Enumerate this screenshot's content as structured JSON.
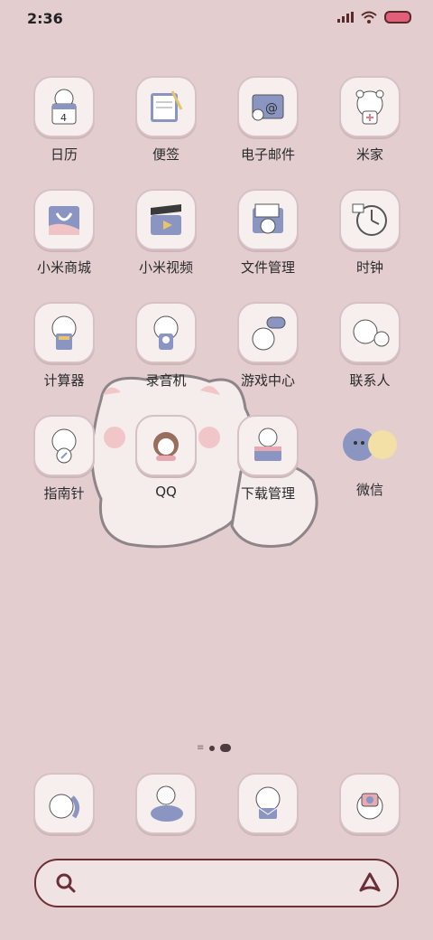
{
  "status_bar": {
    "time": "2:36"
  },
  "apps": [
    {
      "id": "calendar",
      "label": "日历",
      "icon": "calendar-bear-icon"
    },
    {
      "id": "notes",
      "label": "便签",
      "icon": "notes-icon"
    },
    {
      "id": "email",
      "label": "电子邮件",
      "icon": "email-icon"
    },
    {
      "id": "mijia",
      "label": "米家",
      "icon": "mijia-bear-icon"
    },
    {
      "id": "mall",
      "label": "小米商城",
      "icon": "shopping-bag-icon"
    },
    {
      "id": "video",
      "label": "小米视频",
      "icon": "video-clapper-icon"
    },
    {
      "id": "files",
      "label": "文件管理",
      "icon": "folder-bear-icon"
    },
    {
      "id": "clock",
      "label": "时钟",
      "icon": "clock-icon"
    },
    {
      "id": "calculator",
      "label": "计算器",
      "icon": "calculator-bear-icon"
    },
    {
      "id": "recorder",
      "label": "录音机",
      "icon": "recorder-bear-icon"
    },
    {
      "id": "games",
      "label": "游戏中心",
      "icon": "gamepad-bear-icon"
    },
    {
      "id": "contacts",
      "label": "联系人",
      "icon": "contacts-bears-icon"
    },
    {
      "id": "compass",
      "label": "指南针",
      "icon": "compass-bear-icon"
    },
    {
      "id": "qq",
      "label": "QQ",
      "icon": "qq-bear-icon"
    },
    {
      "id": "downloads",
      "label": "下载管理",
      "icon": "download-box-bear-icon"
    },
    {
      "id": "wechat",
      "label": "微信",
      "icon": "wechat-bubbles-icon"
    }
  ],
  "dock": [
    {
      "id": "phone",
      "icon": "phone-bear-icon"
    },
    {
      "id": "browser",
      "icon": "browser-planet-bear-icon"
    },
    {
      "id": "messages",
      "icon": "message-bear-icon"
    },
    {
      "id": "camera",
      "icon": "camera-bear-icon"
    }
  ]
}
